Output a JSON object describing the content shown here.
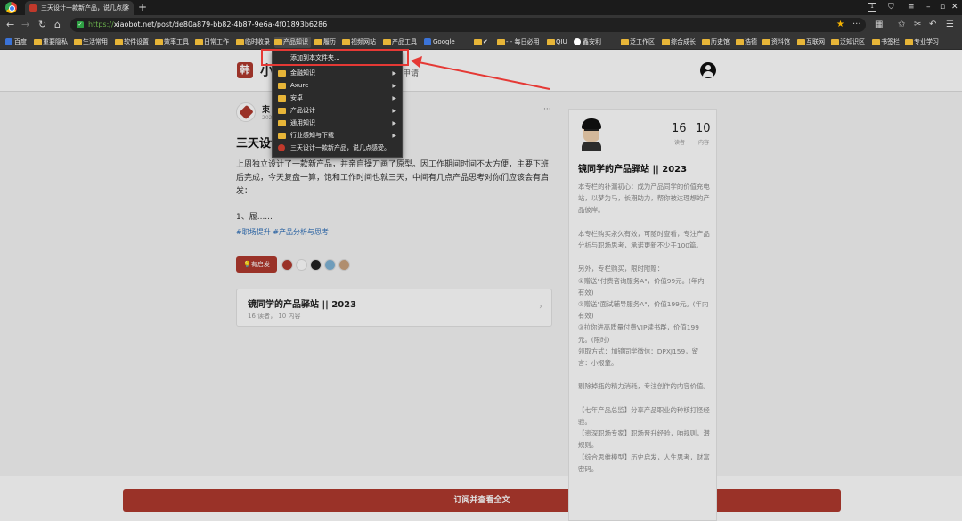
{
  "tab": {
    "title": "三天设计一款新产品，说几点感受"
  },
  "address": {
    "scheme": "https://",
    "rest": "xiaobot.net/post/de80a879-bb82-4b87-9e6a-4f01893b6286"
  },
  "toolbar": {
    "extension_count": "1"
  },
  "bookmarks": [
    "百度",
    "重要隐私",
    "生活常用",
    "软件设置",
    "效率工具",
    "日常工作",
    "临时收录",
    "产品知识",
    "履历",
    "视频网站",
    "产品工具",
    "Google",
    "✔",
    "- - 每日必用",
    "QIU",
    "鑫安利",
    "泛工作区",
    "综合成长",
    "历史馆",
    "浩德",
    "资料馆",
    "互联网",
    "泛知识区",
    "书签栏",
    "专业学习"
  ],
  "menu": {
    "top_item": "添加到本文件夹...",
    "folders": [
      "金融知识",
      "Axure",
      "安卓",
      "产品设计",
      "通用知识",
      "行业感知与下载"
    ],
    "page_item": "三天设计一款新产品，说几点感受。"
  },
  "site": {
    "logo_char": "韩",
    "name_partial": "小",
    "header_link": "申请"
  },
  "post": {
    "author": "束",
    "date": "202",
    "more": "···",
    "title": "三天设计",
    "title_tail": "。",
    "body": "上周独立设计了一款新产品，并亲自操刀画了原型。因工作期间时间不太方便，主要下班后完成，今天复盘一算，饱和工作时间也就三天，中间有几点产品思考对你们应该会有启发：",
    "list": "1、履......",
    "tags": "#职场提升 #产品分析与思考",
    "inspire_label": "有启发"
  },
  "column_card": {
    "title": "镜同学的产品驿站 || 2023",
    "meta": "16 读者，  10 内容",
    "chevron": "›"
  },
  "subscribe": {
    "label": "订阅并查看全文"
  },
  "side": {
    "readers": "16",
    "readers_label": "读者",
    "contents": "10",
    "contents_label": "内容",
    "title": "镜同学的产品驿站 || 2023",
    "desc": "本专栏的补漏初心：成为产品同学的价值充电站，以梦为马，长期助力，帮你被达理想的产品彼岸。\n\n本专栏购买永久有效，可随时查看，专注产品分析与职场思考，承诺更新不少于100篇。\n\n另外，专栏购买，限时附赠：\n①赠送\"付费咨询服务A\"，价值99元。(年内有效)\n②赠送\"面试辅导服务A\"，价值199元。(年内有效)\n③拉你进高质量付费VIP读书群，价值199元。(限时)\n领取方式：加镜同学微信：DPXJ159，留言：小报童。\n\n剔除掉瓶的精力消耗，专注创作的内容价值。\n\n【七年产品总监】分享产品职业的种核打怪经验。\n【资深职场专家】职场晋升经验，咱规则，潜规则。\n【综合思维模型】历史启发，人生思考，财富密码。"
  },
  "colors": {
    "accent": "#b03a2e",
    "annotation": "#e53935",
    "menu_bg": "#2b2b2b"
  }
}
